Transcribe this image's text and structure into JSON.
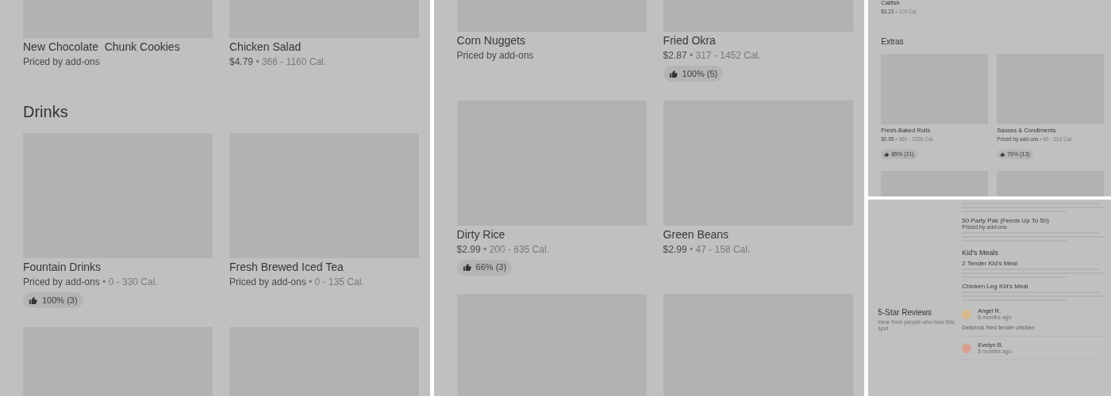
{
  "left_panel": {
    "blocks": [
      {
        "kind": "row",
        "items": [
          {
            "kind": "card",
            "title": "New Chocolate  Chunk Cookies",
            "price": "Priced by add-ons"
          },
          {
            "kind": "card",
            "title": "Chicken Salad",
            "price": "$4.79",
            "calories": "• 366 - 1160 Cal."
          }
        ]
      },
      {
        "kind": "heading",
        "text": "Drinks"
      },
      {
        "kind": "row",
        "items": [
          {
            "kind": "card",
            "title": "Fountain Drinks",
            "price": "Priced by add-ons",
            "calories": "• 0 - 330 Cal.",
            "rating": "100% (3)"
          },
          {
            "kind": "card",
            "title": "Fresh Brewed Iced Tea",
            "price": "Priced by add-ons",
            "calories": "• 0 - 135 Cal."
          }
        ]
      },
      {
        "kind": "row",
        "items": [
          {
            "kind": "image"
          },
          {
            "kind": "image"
          }
        ]
      }
    ]
  },
  "middle_panel": {
    "blocks": [
      {
        "kind": "row",
        "items": [
          {
            "kind": "card",
            "title": "Corn Nuggets",
            "price": "Priced by add-ons"
          },
          {
            "kind": "card",
            "title": "Fried Okra",
            "price": "$2.87",
            "calories": "• 317 - 1452 Cal.",
            "rating": "100% (5)"
          }
        ]
      },
      {
        "kind": "row",
        "items": [
          {
            "kind": "card",
            "title": "Dirty Rice",
            "price": "$2.99",
            "calories": "• 200 - 635 Cal.",
            "rating": "66% (3)"
          },
          {
            "kind": "card",
            "title": "Green Beans",
            "price": "$2.99",
            "calories": "• 47 - 158 Cal."
          }
        ]
      },
      {
        "kind": "row",
        "items": [
          {
            "kind": "image"
          },
          {
            "kind": "image"
          }
        ]
      }
    ]
  },
  "right_top_panel": {
    "blocks": [
      {
        "kind": "row",
        "items": [
          {
            "kind": "text",
            "title": "Catfish",
            "price": "$3.23",
            "calories": "• 119 Cal."
          }
        ]
      },
      {
        "kind": "heading",
        "text": "Extras"
      },
      {
        "kind": "row",
        "items": [
          {
            "kind": "card",
            "title": "Fresh-Baked Rolls",
            "price": "$0.95",
            "calories": "• 960 - 1920 Cal.",
            "rating": "85% (21)"
          },
          {
            "kind": "card",
            "title": "Sauces & Condiments",
            "price": "Priced by add-ons",
            "calories": "• 60 - 210 Cal.",
            "rating": "76% (13)"
          }
        ]
      },
      {
        "kind": "row",
        "items": [
          {
            "kind": "image"
          },
          {
            "kind": "image"
          }
        ]
      }
    ]
  },
  "right_bottom_panel": {
    "blocks": [
      {
        "kind": "blurred_text"
      },
      {
        "kind": "item",
        "title": "50 Party Pak (Feeds Up To 50)",
        "price": "Priced by add-ons"
      },
      {
        "kind": "blurred_text"
      },
      {
        "kind": "heading",
        "text": "Kid's Meals"
      },
      {
        "kind": "item",
        "title": "2 Tender Kid's Meal"
      },
      {
        "kind": "blurred_text"
      },
      {
        "kind": "item",
        "title": "Chicken Leg Kid's Meal"
      },
      {
        "kind": "blurred_text"
      }
    ],
    "reviews": {
      "title": "5-Star Reviews",
      "subtitle": "Hear from people who love this spot",
      "items": [
        {
          "name": "Angel R.",
          "date": "6 months ago",
          "text": "Delicious fried tender chicken",
          "color": "#d8b98c"
        },
        {
          "name": "Evelyn B.",
          "date": "5 months ago",
          "color": "#d8a090"
        }
      ]
    }
  }
}
